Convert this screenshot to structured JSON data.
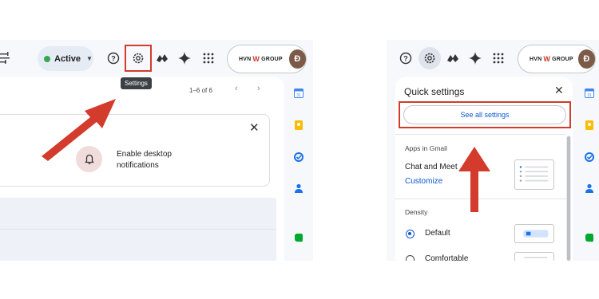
{
  "left_panel": {
    "status": {
      "label": "Active"
    },
    "tooltip": "Settings",
    "pagination": "1–6 of 6",
    "account": {
      "brand_left": "HVN",
      "brand_right": "GROUP",
      "avatar_initial": "Đ"
    },
    "notification": {
      "text": "Enable desktop notifications"
    }
  },
  "right_panel": {
    "account": {
      "brand_left": "HVN",
      "brand_right": "GROUP",
      "avatar_initial": "Đ"
    },
    "quick_settings": {
      "title": "Quick settings",
      "see_all": "See all settings",
      "apps_section": "Apps in Gmail",
      "chat_label": "Chat and Meet",
      "customize": "Customize",
      "density_section": "Density",
      "density_options": [
        "Default",
        "Comfortable"
      ]
    }
  },
  "colors": {
    "highlight": "#d33b2c",
    "accent": "#0b57d0",
    "status_green": "#34a853"
  },
  "icons": [
    "filter-icon",
    "help-icon",
    "settings-icon",
    "apps-icon",
    "gemini-icon",
    "grid-icon",
    "bell-icon",
    "close-icon",
    "calendar-icon",
    "keep-icon",
    "tasks-icon",
    "contacts-icon",
    "evernote-icon"
  ]
}
